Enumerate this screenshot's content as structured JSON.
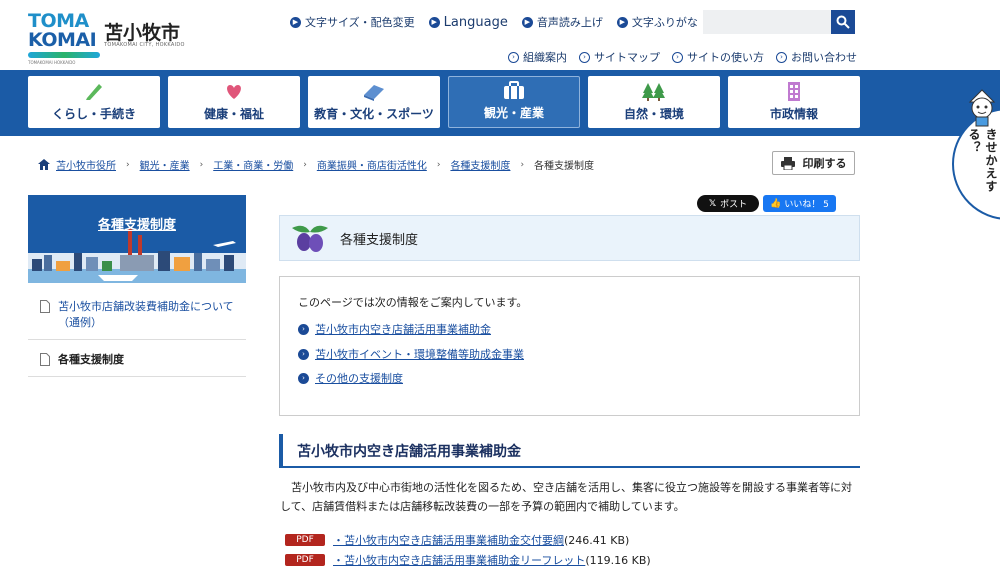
{
  "header": {
    "logo_line1": "TOMA",
    "logo_line2": "KOMAI",
    "logo_tiny": "TOMAKOMAI HOKKAIDO",
    "city_name": "苫小牧市",
    "city_sub": "TOMAKOMAI CITY, HOKKAIDO",
    "top_links": [
      {
        "label": "文字サイズ・配色変更",
        "icon": "arrow-circle-icon"
      },
      {
        "label": "Language",
        "icon": "arrow-circle-icon"
      },
      {
        "label": "音声読み上げ",
        "icon": "arrow-circle-icon"
      },
      {
        "label": "文字ふりがな",
        "icon": "arrow-circle-icon"
      }
    ],
    "search_placeholder": "",
    "sub_links": [
      {
        "label": "組織案内"
      },
      {
        "label": "サイトマップ"
      },
      {
        "label": "サイトの使い方"
      },
      {
        "label": "お問い合わせ"
      }
    ]
  },
  "nav": [
    {
      "label": "くらし・手続き",
      "icon": "pencil-icon",
      "active": false
    },
    {
      "label": "健康・福祉",
      "icon": "heart-icon",
      "active": false
    },
    {
      "label": "教育・文化・スポーツ",
      "icon": "book-icon",
      "active": false
    },
    {
      "label": "観光・産業",
      "icon": "briefcase-icon",
      "active": true
    },
    {
      "label": "自然・環境",
      "icon": "tree-icon",
      "active": false
    },
    {
      "label": "市政情報",
      "icon": "building-icon",
      "active": false
    }
  ],
  "kisekae_label": "きせかえする？",
  "breadcrumb": [
    {
      "label": "苫小牧市役所",
      "link": true
    },
    {
      "label": "観光・産業",
      "link": true
    },
    {
      "label": "工業・商業・労働",
      "link": true
    },
    {
      "label": "商業振興・商店街活性化",
      "link": true
    },
    {
      "label": "各種支援制度",
      "link": true
    },
    {
      "label": "各種支援制度",
      "link": false
    }
  ],
  "print_label": "印刷する",
  "sidebar": {
    "title": "各種支援制度",
    "items": [
      {
        "label": "苫小牧市店舗改装費補助金について（通例）",
        "current": false
      },
      {
        "label": "各種支援制度",
        "current": true
      }
    ]
  },
  "social": {
    "x_label": "ポスト",
    "fb_label": "いいね！ 5"
  },
  "page_title": "各種支援制度",
  "toc": {
    "intro": "このページでは次の情報をご案内しています。",
    "links": [
      "苫小牧市内空き店舗活用事業補助金",
      "苫小牧市イベント・環境整備等助成金事業",
      "その他の支援制度"
    ]
  },
  "section": {
    "heading": "苫小牧市内空き店舗活用事業補助金",
    "body": "苫小牧市内及び中心市街地の活性化を図るため、空き店舗を活用し、集客に役立つ施設等を開設する事業者等に対して、店舗賃借料または店舗移転改装費の一部を予算の範囲内で補助しています。",
    "pdf_label": "PDF",
    "files": [
      {
        "title": "・苫小牧市内空き店舗活用事業補助金交付要綱",
        "size": "(246.41 KB)"
      },
      {
        "title": "・苫小牧市内空き店舗活用事業補助金リーフレット",
        "size": "(119.16 KB)"
      }
    ]
  }
}
